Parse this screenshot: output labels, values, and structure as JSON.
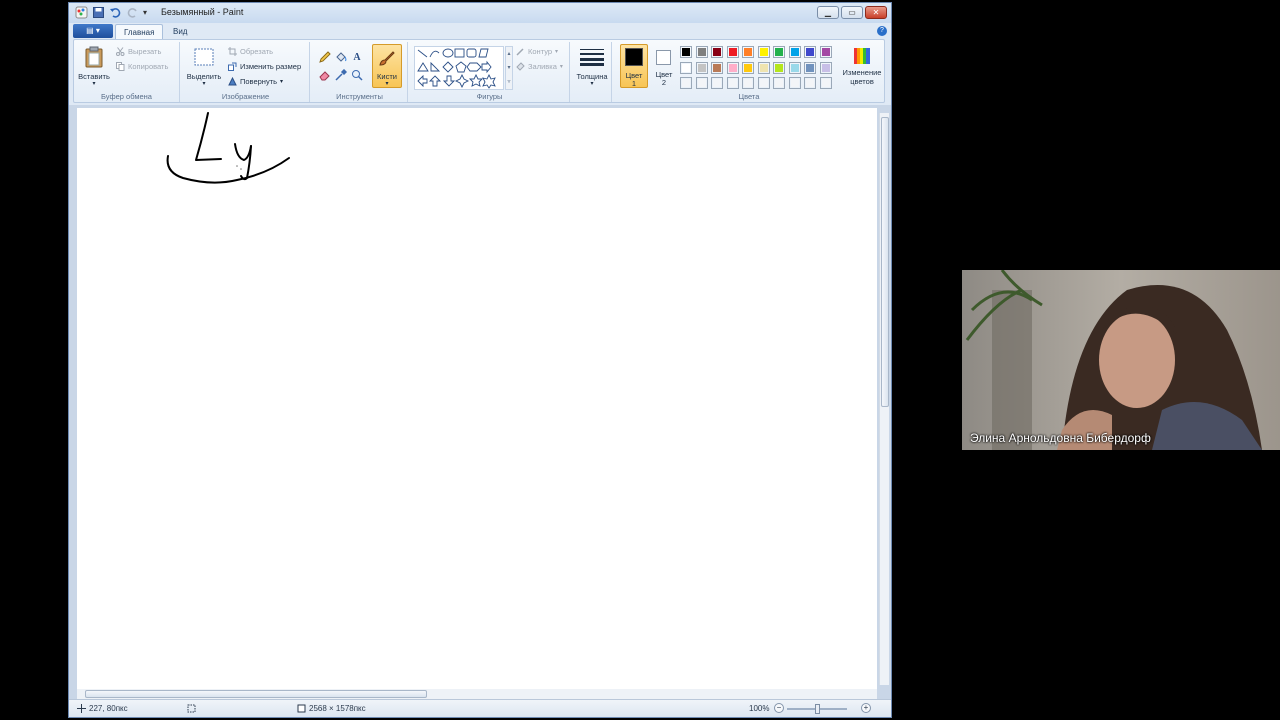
{
  "window": {
    "title": "Безымянный - Paint"
  },
  "tabs": {
    "file": "▤ ▾",
    "home": "Главная",
    "view": "Вид"
  },
  "ribbon": {
    "clipboard": {
      "group_label": "Буфер обмена",
      "paste": "Вставить",
      "cut": "Вырезать",
      "copy": "Копировать"
    },
    "image": {
      "group_label": "Изображение",
      "select": "Выделить",
      "crop": "Обрезать",
      "resize": "Изменить размер",
      "rotate": "Повернуть"
    },
    "tools": {
      "group_label": "Инструменты",
      "brushes": "Кисти"
    },
    "shapes": {
      "group_label": "Фигуры",
      "outline": "Контур",
      "fill": "Заливка"
    },
    "size": {
      "label": "Толщина"
    },
    "colors": {
      "group_label": "Цвета",
      "color1_label": "Цвет",
      "color1_num": "1",
      "color2_label": "Цвет",
      "color2_num": "2",
      "edit_colors": "Изменение цветов",
      "color1_value": "#000000",
      "color2_value": "#ffffff",
      "palette_row1": [
        "#000000",
        "#7f7f7f",
        "#880015",
        "#ed1c24",
        "#ff7f27",
        "#fff200",
        "#22b14c",
        "#00a2e8",
        "#3f48cc",
        "#a349a4"
      ],
      "palette_row2": [
        "#ffffff",
        "#c3c3c3",
        "#b97a57",
        "#ffaec9",
        "#ffc90e",
        "#efe4b0",
        "#b5e61d",
        "#99d9ea",
        "#7092be",
        "#c8bfe7"
      ],
      "palette_row3": [
        "#ffffff",
        "#ffffff",
        "#ffffff",
        "#ffffff",
        "#ffffff",
        "#ffffff",
        "#ffffff",
        "#ffffff",
        "#ffffff",
        "#ffffff"
      ]
    }
  },
  "status": {
    "cursor_pos": "227, 80пкс",
    "canvas_size": "2568 × 1578пкс",
    "zoom": "100%"
  },
  "webcam": {
    "participant_name": "Элина Арнольдовна Бибердорф"
  }
}
